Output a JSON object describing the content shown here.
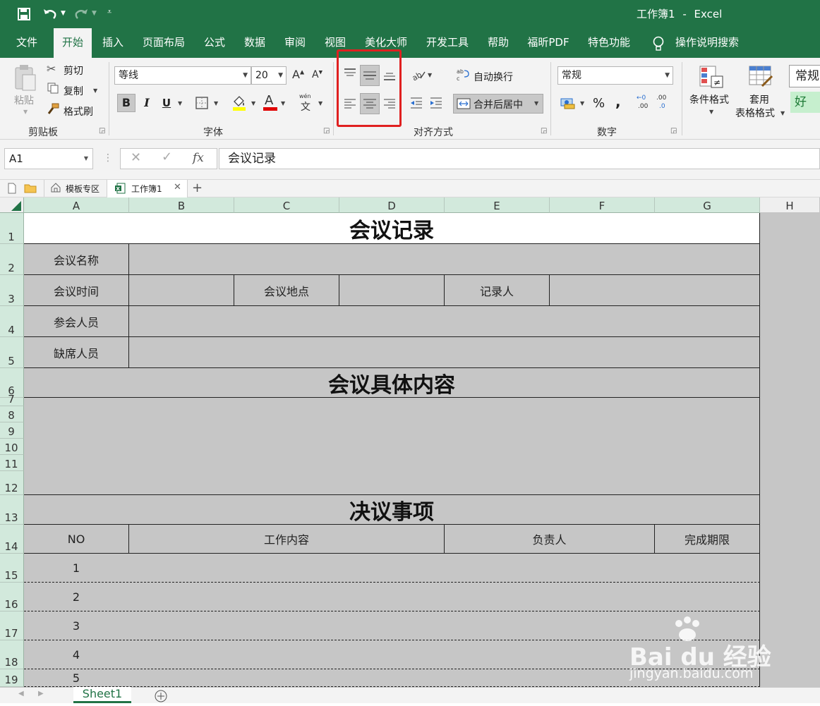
{
  "title": {
    "workbook": "工作簿1",
    "separator": "-",
    "app": "Excel"
  },
  "menu": [
    "文件",
    "开始",
    "插入",
    "页面布局",
    "公式",
    "数据",
    "审阅",
    "视图",
    "美化大师",
    "开发工具",
    "帮助",
    "福昕PDF",
    "特色功能",
    "操作说明搜索"
  ],
  "ribbon": {
    "clipboard": {
      "paste": "粘贴",
      "cut": "剪切",
      "copy": "复制",
      "format_painter": "格式刷",
      "label": "剪贴板"
    },
    "font": {
      "name": "等线",
      "size": "20",
      "label": "字体",
      "bold": "B",
      "italic": "I",
      "underline": "U",
      "font_color_letter": "A",
      "phonetic": "wén"
    },
    "alignment": {
      "wrap": "自动换行",
      "merge": "合并后居中",
      "label": "对齐方式"
    },
    "number": {
      "format": "常规",
      "percent": "%",
      "comma": ",",
      "label": "数字",
      "inc_decimal": ".00",
      "dec_decimal": ".0"
    },
    "styles": {
      "conditional": "条件格式",
      "table_format_1": "套用",
      "table_format_2": "表格格式",
      "style_normal": "常规",
      "style_good": "好"
    }
  },
  "formula_bar": {
    "name_box": "A1",
    "fx": "fx",
    "content": "会议记录"
  },
  "tabs": {
    "template": "模板专区",
    "workbook": "工作簿1",
    "add": "+"
  },
  "columns": [
    "A",
    "B",
    "C",
    "D",
    "E",
    "F",
    "G",
    "H"
  ],
  "rows": [
    "1",
    "2",
    "3",
    "4",
    "5",
    "6",
    "7",
    "8",
    "9",
    "10",
    "11",
    "12",
    "13",
    "14",
    "15",
    "16",
    "17",
    "18",
    "19"
  ],
  "sheet": {
    "title": "会议记录",
    "meeting_name": "会议名称",
    "meeting_time": "会议时间",
    "meeting_place": "会议地点",
    "recorder": "记录人",
    "attendees": "参会人员",
    "absentees": "缺席人员",
    "content_title": "会议具体内容",
    "resolution_title": "决议事项",
    "headers": {
      "no": "NO",
      "work": "工作内容",
      "owner": "负责人",
      "deadline": "完成期限"
    },
    "numbers": [
      "1",
      "2",
      "3",
      "4",
      "5"
    ]
  },
  "sheet_tab": "Sheet1",
  "watermark": {
    "brand": "Bai du 经验",
    "url": "jingyan.baidu.com"
  },
  "colors": {
    "excel_green": "#217346",
    "highlight": "#e02020",
    "cell_fill": "#c6c6c6",
    "header_green": "#d2e9dc"
  }
}
